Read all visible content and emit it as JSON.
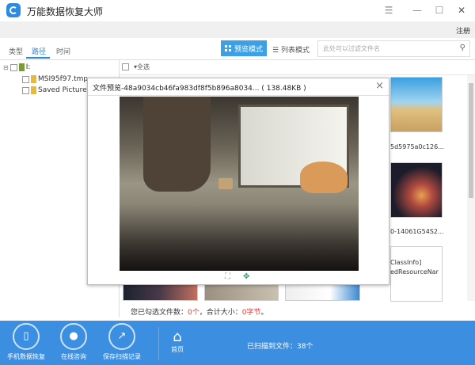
{
  "app": {
    "title": "万能数据恢复大师",
    "register": "注册"
  },
  "window_controls": {
    "menu": "☰",
    "minimize": "—",
    "maximize": "☐",
    "close": "✕"
  },
  "tabs": [
    {
      "label": "类型"
    },
    {
      "label": "路径"
    },
    {
      "label": "时间"
    }
  ],
  "toolbar": {
    "preview_mode": "预览模式",
    "list_mode": "列表模式",
    "search_placeholder": "此处可以过滤文件名"
  },
  "tree": {
    "root": "I:",
    "children": [
      "MSI95f97.tmp",
      "Saved Pictures"
    ]
  },
  "grid": {
    "select_all": "全选",
    "captions": [
      "5d5975a0c126...",
      "0-14061G54S2...",
      "ClassInfo]",
      "edResourceNar"
    ]
  },
  "status": {
    "prefix": "您已勾选文件数：",
    "count": "0个",
    "mid": "，合计大小：",
    "size": "0字节",
    "suffix": "。"
  },
  "dialog": {
    "title": "文件预览-48a9034cb46fa983df8f5b896a8034... ( 138.48KB )",
    "close": "×"
  },
  "bottom": {
    "phone": "手机数据恢复",
    "consult": "在线咨询",
    "save": "保存扫描记录",
    "home": "首页",
    "scanned": "已扫描到文件：38个"
  }
}
